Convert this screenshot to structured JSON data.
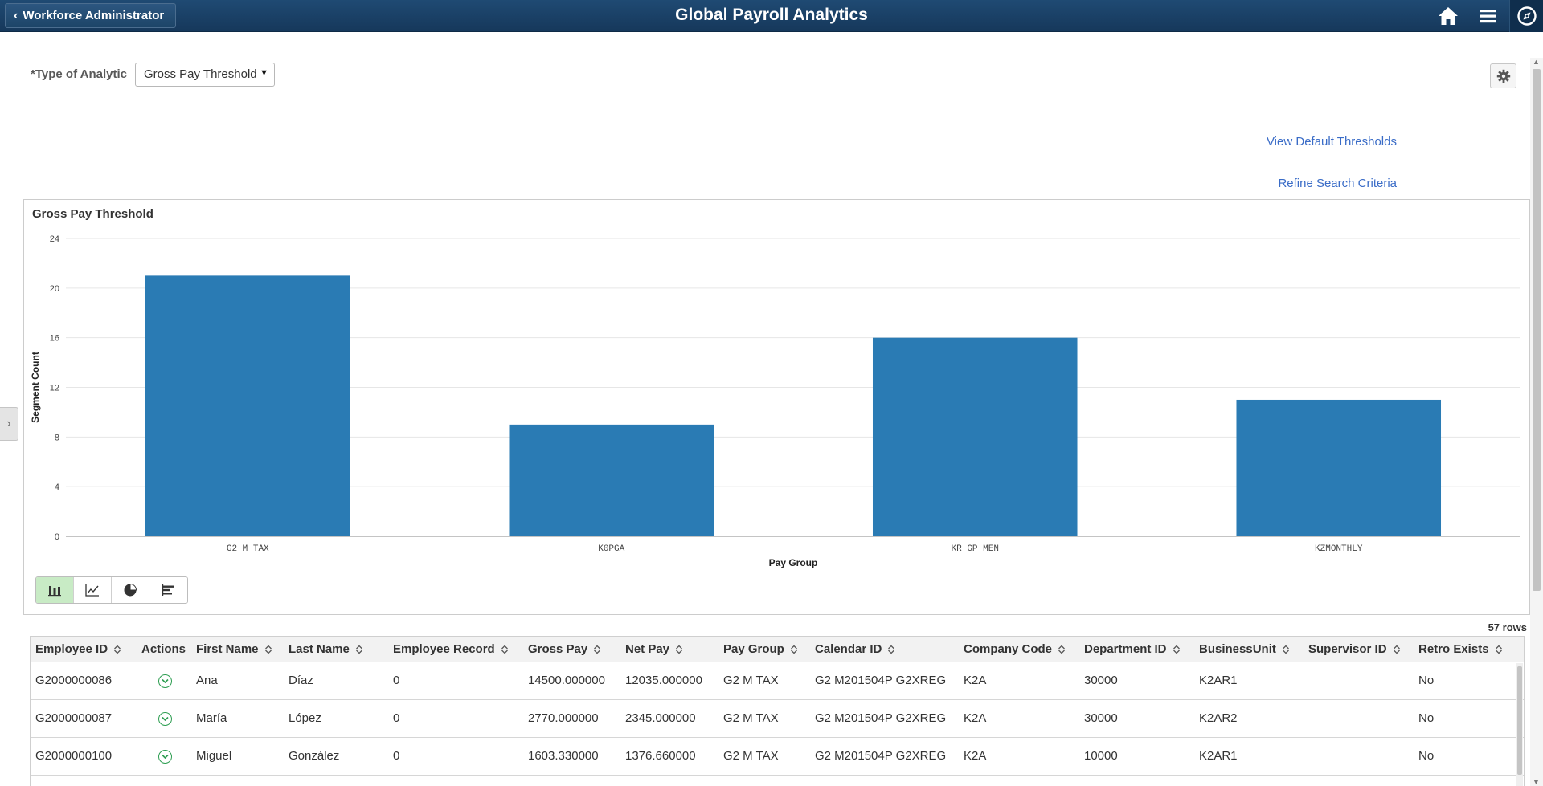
{
  "header": {
    "back_label": "Workforce Administrator",
    "title": "Global Payroll Analytics",
    "icons": [
      "home-icon",
      "menu-icon",
      "navbar-compass-icon"
    ]
  },
  "filter": {
    "type_label": "*Type of Analytic",
    "type_value": "Gross Pay Threshold"
  },
  "links": {
    "view_defaults": "View Default Thresholds",
    "refine": "Refine Search Criteria"
  },
  "chart_data": {
    "type": "bar",
    "title": "Gross Pay Threshold",
    "xlabel": "Pay Group",
    "ylabel": "Segment Count",
    "categories": [
      "G2 M TAX",
      "K0PGA",
      "KR GP MEN",
      "KZMONTHLY"
    ],
    "values": [
      21,
      9,
      16,
      11
    ],
    "ylim": [
      0,
      24
    ],
    "yticks": [
      0,
      4,
      8,
      12,
      16,
      20,
      24
    ],
    "grid": true,
    "legend": "none",
    "bar_color": "#2a7bb4"
  },
  "chart_tools": [
    "bar-chart-icon",
    "line-chart-icon",
    "pie-chart-icon",
    "horizontal-bar-chart-icon"
  ],
  "grid": {
    "row_count": "57 rows",
    "columns": [
      "Employee ID",
      "Actions",
      "First Name",
      "Last Name",
      "Employee Record",
      "Gross Pay",
      "Net Pay",
      "Pay Group",
      "Calendar ID",
      "Company Code",
      "Department ID",
      "BusinessUnit",
      "Supervisor ID",
      "Retro Exists"
    ],
    "rows": [
      [
        "G2000000086",
        "",
        "Ana",
        "Díaz",
        "0",
        "14500.000000",
        "12035.000000",
        "G2 M TAX",
        "G2 M201504P G2XREG",
        "K2A",
        "30000",
        "K2AR1",
        "",
        "No"
      ],
      [
        "G2000000087",
        "",
        "María",
        "López",
        "0",
        "2770.000000",
        "2345.000000",
        "G2 M TAX",
        "G2 M201504P G2XREG",
        "K2A",
        "30000",
        "K2AR2",
        "",
        "No"
      ],
      [
        "G2000000100",
        "",
        "Miguel",
        "González",
        "0",
        "1603.330000",
        "1376.660000",
        "G2 M TAX",
        "G2 M201504P G2XREG",
        "K2A",
        "10000",
        "K2AR1",
        "",
        "No"
      ]
    ]
  }
}
